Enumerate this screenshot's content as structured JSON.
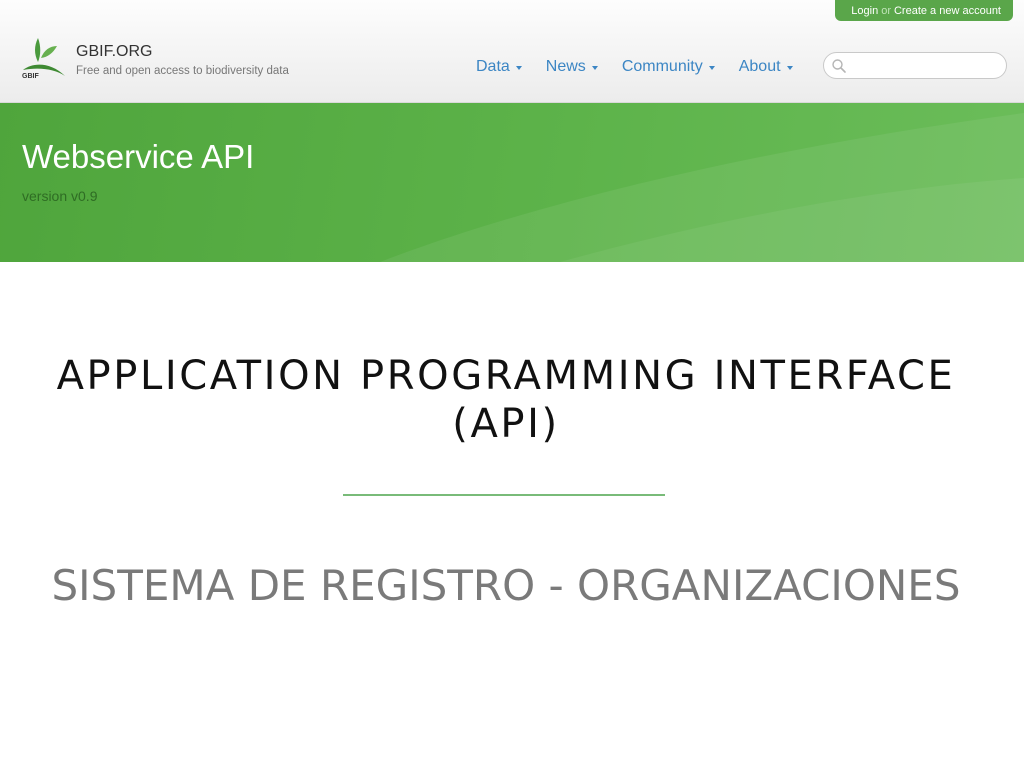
{
  "header": {
    "login_label": "Login",
    "or_label": "or",
    "create_account_label": "Create a new account",
    "site_title": "GBIF.ORG",
    "tagline": "Free and open access to biodiversity data",
    "logo_text": "GBIF",
    "search": {
      "value": "",
      "placeholder": ""
    }
  },
  "nav": {
    "items": [
      {
        "label": "Data"
      },
      {
        "label": "News"
      },
      {
        "label": "Community"
      },
      {
        "label": "About"
      }
    ]
  },
  "banner": {
    "title": "Webservice API",
    "version": "version v0.9"
  },
  "slide": {
    "title_line1": "APPLICATION PROGRAMMING INTERFACE",
    "title_line2": "(API)",
    "subtitle": "SISTEMA DE REGISTRO - ORGANIZACIONES"
  },
  "colors": {
    "brand_green": "#5aa64a",
    "link_blue": "#3c86c4",
    "divider_green": "#79bb79"
  },
  "icons": [
    "gbif-logo-icon",
    "search-icon",
    "chevron-down-icon"
  ]
}
